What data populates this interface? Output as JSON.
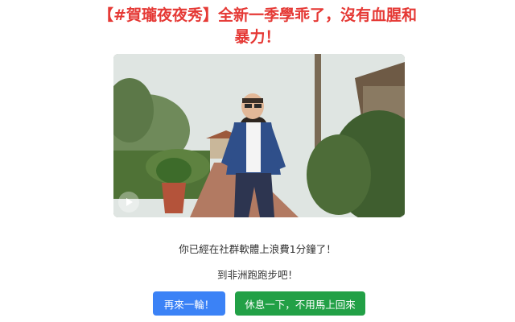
{
  "headline": "【#賀瓏夜夜秀】全新一季學乖了，沒有血腥和暴力！",
  "video": {
    "thumbnail_icon": "play-icon"
  },
  "messages": {
    "wasted_time": "你已經在社群軟體上浪費1分鐘了！",
    "suggestion": "到非洲跑跑步吧！"
  },
  "buttons": {
    "again_label": "再來一輪！",
    "rest_label": "休息一下，不用馬上回來"
  },
  "colors": {
    "headline": "#e53935",
    "primary_button": "#3b82f6",
    "secondary_button": "#22a046"
  }
}
